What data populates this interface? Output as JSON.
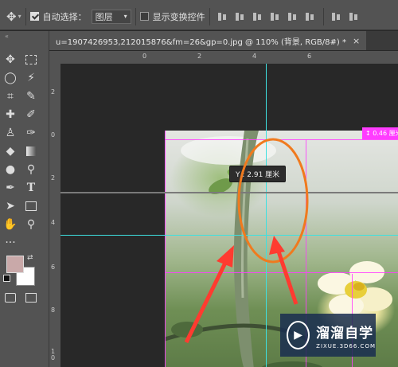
{
  "options_bar": {
    "auto_select_label": "自动选择：",
    "auto_select_checked": true,
    "auto_select_value": "图层",
    "show_transform_label": "显示变换控件",
    "show_transform_checked": false
  },
  "document_tab": {
    "title": "u=1907426953,212015876&fm=26&gp=0.jpg @ 110% (背景, RGB/8#) *",
    "close_glyph": "×"
  },
  "rulers": {
    "horizontal_ticks": [
      "0",
      "2",
      "4",
      "6"
    ],
    "vertical_ticks": [
      "2",
      "0",
      "2",
      "4",
      "6",
      "8",
      "10"
    ]
  },
  "canvas": {
    "tooltip_text": "Y : 2.91 厘米",
    "pink_tag_text": "0.46 厘米",
    "pink_arrow": "↕"
  },
  "watermark": {
    "title": "溜溜自学",
    "subtitle": "ZIXUE.3D66.COM"
  },
  "colors": {
    "foreground": "#c9a9a9",
    "background": "#ffffff",
    "guide": "#3ee0e0",
    "grid": "#ff3cff",
    "annotation": "#ff3b30",
    "ellipse": "#f07a1e"
  },
  "icons": {
    "move_tool": "move-icon",
    "marquee_tool": "marquee-icon",
    "lasso_tool": "lasso-icon",
    "magic_wand_tool": "magic-wand-icon",
    "crop_tool": "crop-icon",
    "eyedropper_tool": "eyedropper-icon",
    "healing_tool": "healing-icon",
    "brush_tool": "brush-icon",
    "stamp_tool": "stamp-icon",
    "history_brush_tool": "history-brush-icon",
    "eraser_tool": "eraser-icon",
    "gradient_tool": "gradient-icon",
    "blur_tool": "blur-icon",
    "dodge_tool": "dodge-icon",
    "pen_tool": "pen-icon",
    "type_tool": "type-icon",
    "path_select_tool": "path-select-icon",
    "shape_tool": "shape-icon",
    "hand_tool": "hand-icon",
    "zoom_tool": "zoom-icon",
    "more_tools": "more-icon",
    "quick_mask": "quick-mask-icon",
    "screen_mode": "screen-mode-icon"
  }
}
